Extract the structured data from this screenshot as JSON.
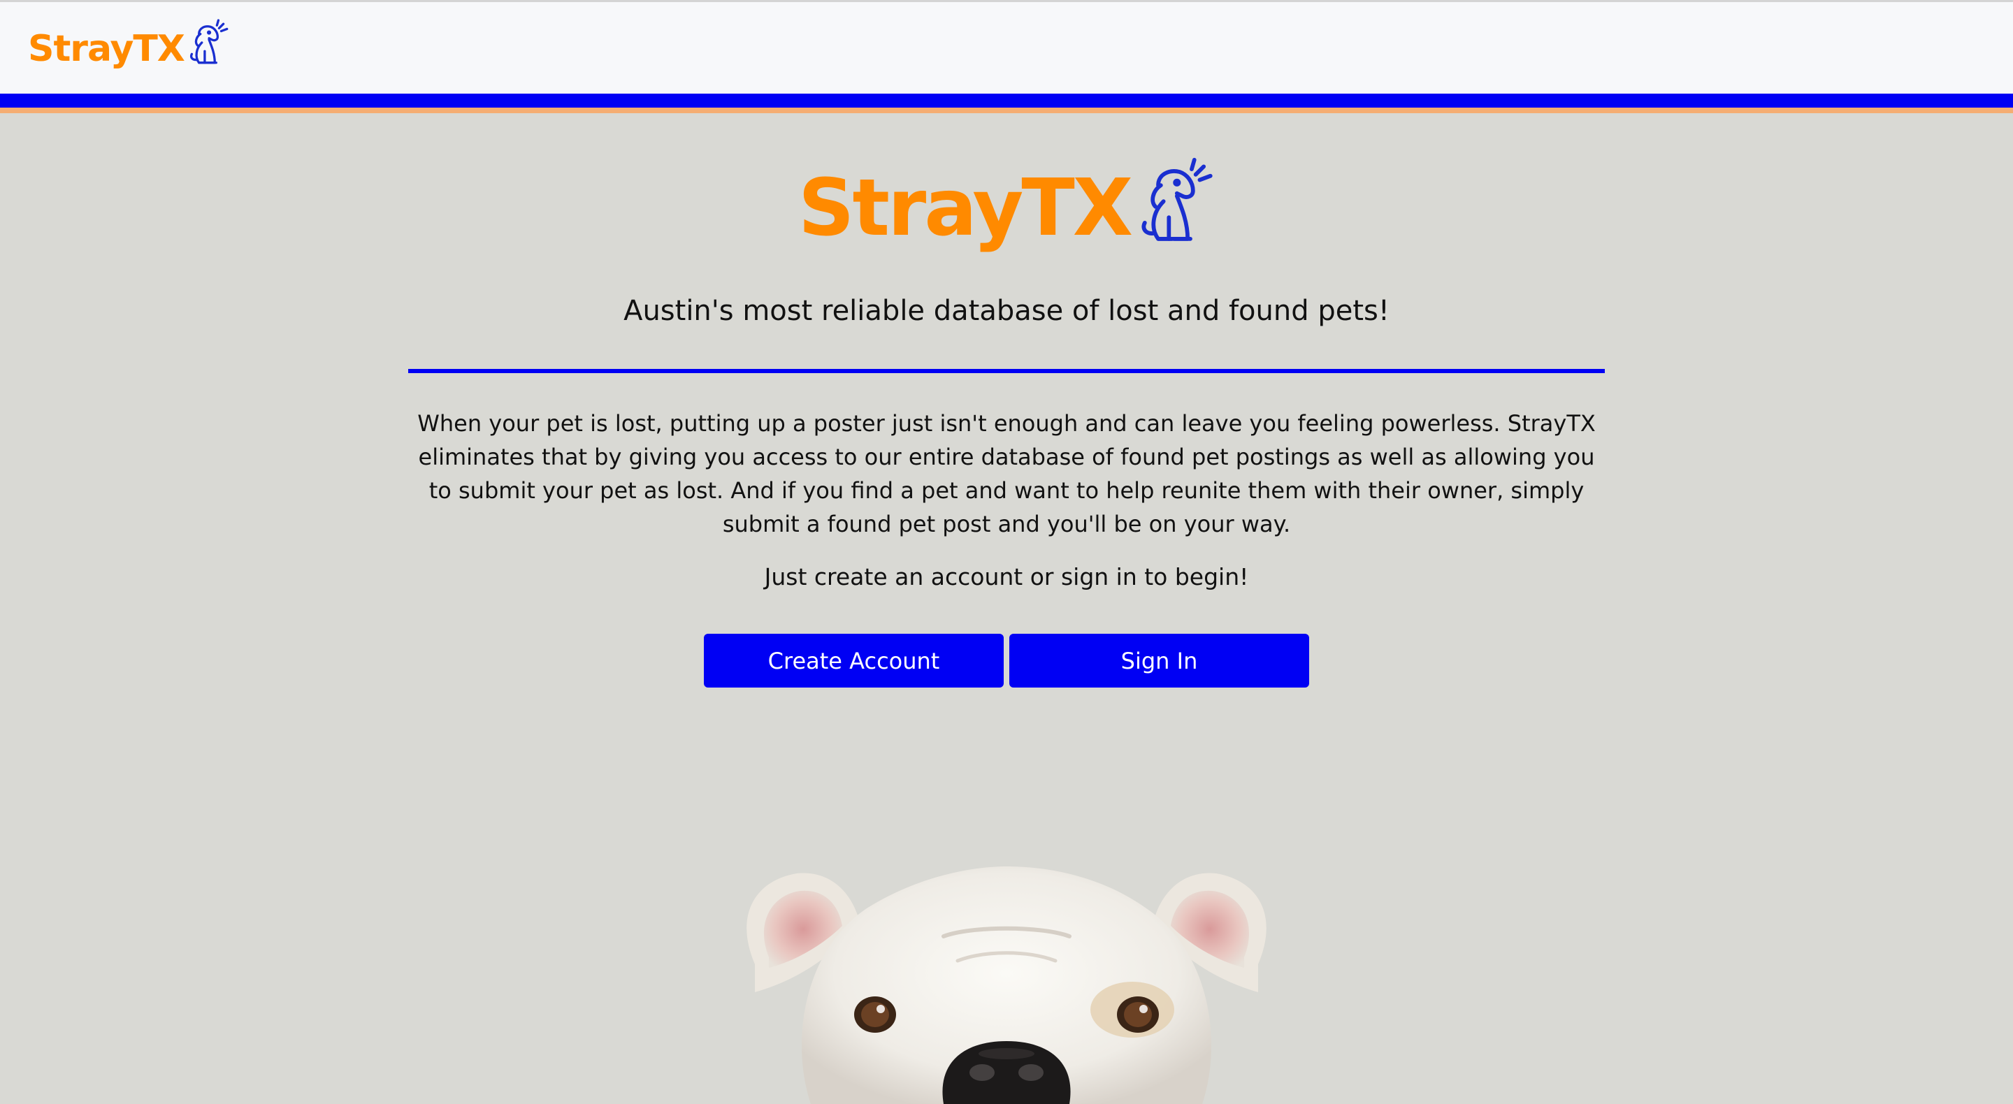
{
  "navbar": {
    "brand_text": "StrayTX",
    "brand_icon": "dog-logo-icon"
  },
  "hero": {
    "logo_text": "StrayTX",
    "logo_icon": "dog-logo-icon",
    "tagline": "Austin's most reliable database of lost and found pets!",
    "description": "When your pet is lost, putting up a poster just isn't enough and can leave you feeling powerless. StrayTX eliminates that by giving you access to our entire database of found pet postings as well as allowing you to submit your pet as lost. And if you find a pet and want to help reunite them with their owner, simply submit a found pet post and you'll be on your way.",
    "cta": "Just create an account or sign in to begin!"
  },
  "buttons": {
    "create_account": "Create Account",
    "sign_in": "Sign In"
  },
  "colors": {
    "brand_orange": "#ff8a00",
    "brand_blue": "#0000f4",
    "accent_stripe": "#f5ad72",
    "page_background": "#d9d9d4",
    "navbar_background": "#f7f8fa"
  },
  "image": {
    "subject": "bulldog-photo"
  }
}
